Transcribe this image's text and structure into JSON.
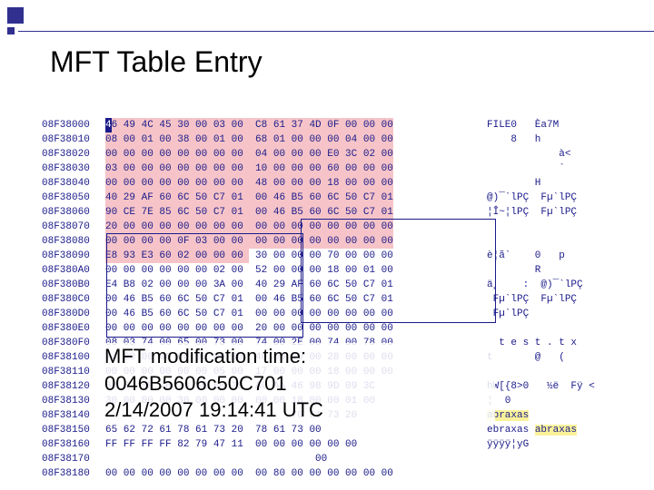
{
  "title": "MFT Table Entry",
  "overlay": {
    "line1": "MFT modification time:",
    "line2": "0046B5606c50C701",
    "line3": "2/14/2007 19:14:41 UTC"
  },
  "hex_rows": [
    {
      "off": "08F38000",
      "b1": "46 49 4C 45 30 00 03 00 ",
      "b2": " C8 61 37 4D 0F 00 00 00",
      "asc": "FILE0   Èa7M",
      "hl": "pink",
      "cursor": true
    },
    {
      "off": "08F38010",
      "b1": "08 00 01 00 38 00 01 00 ",
      "b2": " 68 01 00 00 00 04 00 00",
      "asc": "    8   h",
      "hl": "pink"
    },
    {
      "off": "08F38020",
      "b1": "00 00 00 00 00 00 00 00 ",
      "b2": " 04 00 00 00 E0 3C 02 00",
      "asc": "            à<",
      "hl": "pink"
    },
    {
      "off": "08F38030",
      "b1": "03 00 00 00 00 00 00 00 ",
      "b2": " 10 00 00 00 60 00 00 00",
      "asc": "            `",
      "hl": "pink"
    },
    {
      "off": "08F38040",
      "b1": "00 00 00 00 00 00 00 00 ",
      "b2": " 48 00 00 00 18 00 00 00",
      "asc": "        H",
      "hl": "pink"
    },
    {
      "off": "08F38050",
      "b1": "40 29 AF 60 6C 50 C7 01 ",
      "b2": " 00 46 B5 60 6C 50 C7 01",
      "asc": "@)¯`lPÇ  Fµ`lPÇ",
      "hl": "pink"
    },
    {
      "off": "08F38060",
      "b1": "90 CE 7E 85 6C 50 C7 01 ",
      "b2": " 00 46 B5 60 6C 50 C7 01",
      "asc": "¦Î~¦lPÇ  Fµ`lPÇ",
      "hl": "pink"
    },
    {
      "off": "08F38070",
      "b1": "20 00 00 00 00 00 00 00 ",
      "b2": " 00 00 00 00 00 00 00 00",
      "asc": "",
      "hl": "pink"
    },
    {
      "off": "08F38080",
      "b1": "00 00 00 00 0F 03 00 00 ",
      "b2": " 00 00 00 00 00 00 00 00",
      "asc": "",
      "hl": "pink"
    },
    {
      "off": "08F38090",
      "b1": "E8 93 E3 60 02 00 00 00 ",
      "b2": " 30 00 00 00 70 00 00 00",
      "asc": "è¦ã`    0   p",
      "hl": "pink-half"
    },
    {
      "off": "08F380A0",
      "b1": "00 00 00 00 00 00 02 00 ",
      "b2": " 52 00 00 00 18 00 01 00",
      "asc": "        R",
      "hl": "none"
    },
    {
      "off": "08F380B0",
      "b1": "E4 B8 02 00 00 00 3A 00 ",
      "b2": " 40 29 AF 60 6C 50 C7 01",
      "asc": "ä¸    :  @)¯`lPÇ",
      "hl": "none"
    },
    {
      "off": "08F380C0",
      "b1": "00 46 B5 60 6C 50 C7 01 ",
      "b2": " 00 46 B5 60 6C 50 C7 01",
      "asc": " Fµ`lPÇ  Fµ`lPÇ",
      "hl": "none"
    },
    {
      "off": "08F380D0",
      "b1": "00 46 B5 60 6C 50 C7 01 ",
      "b2": " 00 00 00 00 00 00 00 00",
      "asc": " Fµ`lPÇ",
      "hl": "none"
    },
    {
      "off": "08F380E0",
      "b1": "00 00 00 00 00 00 00 00 ",
      "b2": " 20 00 00 00 00 00 00 00",
      "asc": "",
      "hl": "none"
    },
    {
      "off": "08F380F0",
      "b1": "08 03 74 00 65 00 73 00 ",
      "b2": " 74 00 2E 00 74 00 78 00",
      "asc": "  t e s t . t x",
      "hl": "none"
    },
    {
      "off": "08F38100",
      "b1": "74 00 00 00 00 00 00 00 ",
      "b2": " 40 00 00 00 28 00 00 00",
      "asc": "t       @   (",
      "hl": "none"
    },
    {
      "off": "08F38110",
      "b1": "00 00 00 00 00 00 05 00 ",
      "b2": " 17 00 00 00 18 00 00 00",
      "asc": "",
      "hl": "none"
    },
    {
      "off": "08F38120",
      "b1": "68 37 5F 7B 38 3E E0 29 ",
      "b2": " A0 AA 46 98 9D 09 3C",
      "asc": "hW[{8>0   ½ë  Fÿ <",
      "hl": "none"
    },
    {
      "off": "08F38130",
      "b1": "30 00 00 00 30 00 00 00 ",
      "b2": " 00 00 18 00 00 01 00 ",
      "asc": "¦  0",
      "hl": "none"
    },
    {
      "off": "08F38140",
      "b1": "                        ",
      "b2": "       70 61 73 20",
      "asc": "",
      "asc_tail": "abraxas",
      "hl": "none"
    },
    {
      "off": "08F38150",
      "b1": "65 62 72 61 78 61 73 20 ",
      "b2": " 78 61 73 00",
      "asc": "ebraxas ",
      "asc_tail": "abraxas",
      "hl": "none"
    },
    {
      "off": "08F38160",
      "b1": "FF FF FF FF 82 79 47 11 ",
      "b2": " 00 00 00 00 00 00",
      "asc": "ÿÿÿÿ¦yG",
      "hl": "none"
    },
    {
      "off": "08F38170",
      "b1": "                        ",
      "b2": "           00",
      "asc": "",
      "hl": "none"
    },
    {
      "off": "08F38180",
      "b1": "00 00 00 00 00 00 00 00 ",
      "b2": " 00 80 00 00 00 00 00 00",
      "asc": "",
      "hl": "none"
    }
  ]
}
